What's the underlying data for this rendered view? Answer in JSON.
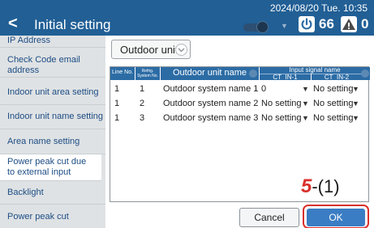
{
  "header": {
    "back_glyph": "<",
    "title": "Initial setting",
    "datetime": "2024/08/20 Tue. 10:35",
    "power_count": "66",
    "warning_count": "0",
    "toggle_arrow": "▼"
  },
  "sidebar": {
    "items": [
      {
        "label": "IP Address"
      },
      {
        "label": "Check Code email address"
      },
      {
        "label": "Indoor unit area setting"
      },
      {
        "label": "Indoor unit name setting"
      },
      {
        "label": "Area name setting"
      },
      {
        "label": "Power peak cut due to external input"
      },
      {
        "label": "Backlight"
      },
      {
        "label": "Power peak cut"
      }
    ]
  },
  "main": {
    "unit_select_label": "Outdoor unit",
    "table": {
      "col_line_no": "Line No.",
      "col_refrig_no": "Refrig. System No.",
      "col_name": "Outdoor unit name",
      "col_input_group": "Input signal name",
      "col_ct1": "CT_IN-1",
      "col_ct2": "CT_IN-2",
      "rows": [
        {
          "line": "1",
          "refrig": "1",
          "name": "Outdoor system name 1",
          "ct1": "0",
          "ct2": "No setting"
        },
        {
          "line": "1",
          "refrig": "2",
          "name": "Outdoor system name 2",
          "ct1": "No setting",
          "ct2": "No setting"
        },
        {
          "line": "1",
          "refrig": "3",
          "name": "Outdoor system name 3",
          "ct1": "No setting",
          "ct2": "No setting"
        }
      ]
    },
    "cancel_label": "Cancel",
    "ok_label": "OK",
    "step_number": "5",
    "step_suffix": "-(1)"
  },
  "colors": {
    "header_bg": "#215f95",
    "table_header_bg": "#2c6ca5",
    "ok_button": "#3a7dc4",
    "highlight_ring": "#d9302c",
    "sidebar_bg": "#dfe2e4"
  }
}
